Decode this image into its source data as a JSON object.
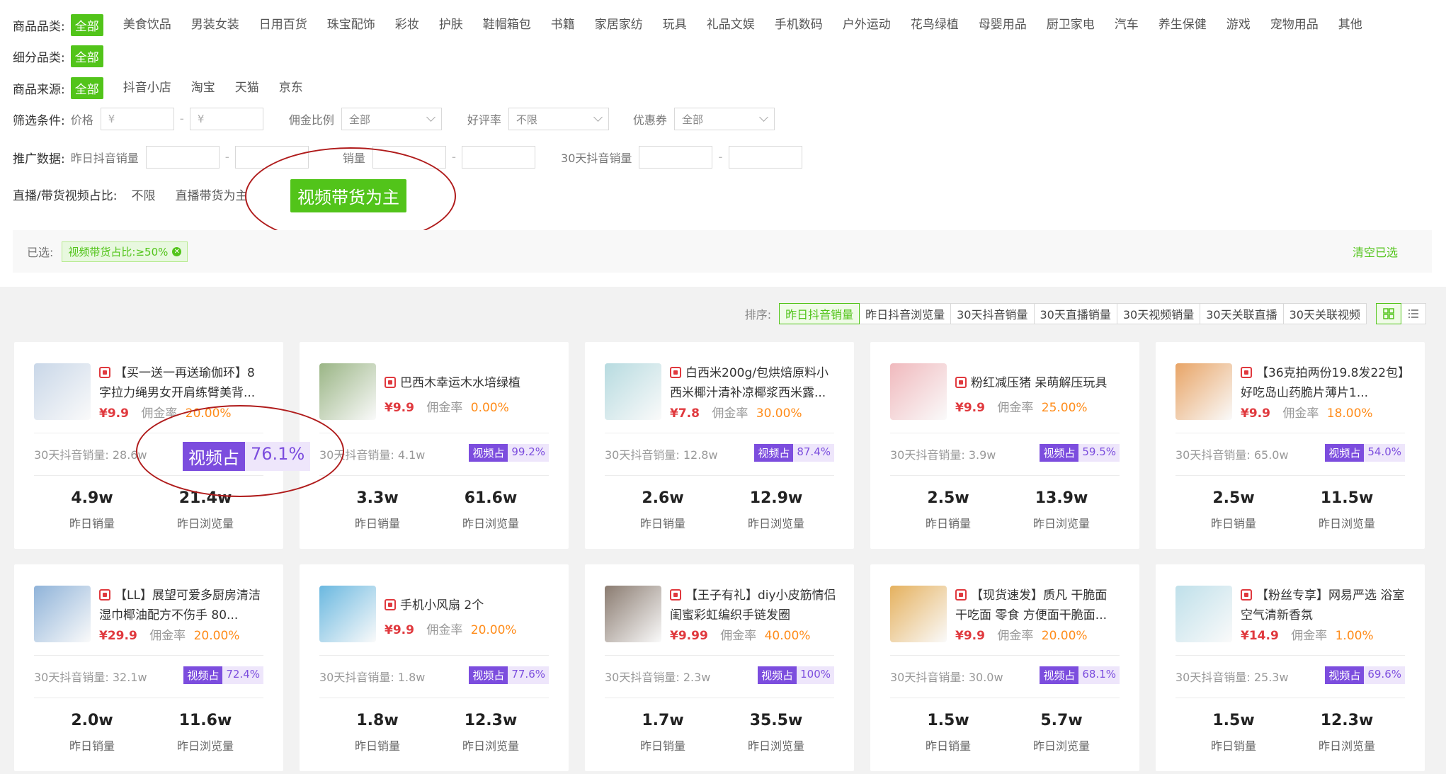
{
  "filters": {
    "category": {
      "label": "商品品类:",
      "options": [
        "全部",
        "美食饮品",
        "男装女装",
        "日用百货",
        "珠宝配饰",
        "彩妆",
        "护肤",
        "鞋帽箱包",
        "书籍",
        "家居家纺",
        "玩具",
        "礼品文娱",
        "手机数码",
        "户外运动",
        "花鸟绿植",
        "母婴用品",
        "厨卫家电",
        "汽车",
        "养生保健",
        "游戏",
        "宠物用品",
        "其他"
      ]
    },
    "subcategory": {
      "label": "细分品类:",
      "options": [
        "全部"
      ]
    },
    "source": {
      "label": "商品来源:",
      "options": [
        "全部",
        "抖音小店",
        "淘宝",
        "天猫",
        "京东"
      ]
    },
    "conditions": {
      "label": "筛选条件:",
      "price_label": "价格",
      "price_min_placeholder": "¥",
      "price_max_placeholder": "¥",
      "commission_label": "佣金比例",
      "commission_value": "全部",
      "rating_label": "好评率",
      "rating_value": "不限",
      "coupon_label": "优惠券",
      "coupon_value": "全部"
    },
    "promo": {
      "label": "推广数据:",
      "yesterday_sales_label": "昨日抖音销量",
      "partial_label": "销量",
      "sales30_label": "30天抖音销量"
    },
    "ratio": {
      "label": "直播/带货视频占比:",
      "options": [
        "不限",
        "直播带货为主"
      ],
      "highlight": "视频带货为主"
    },
    "selected": {
      "label": "已选:",
      "tag": "视频带货占比:≥50%",
      "clear": "清空已选"
    }
  },
  "sort": {
    "label": "排序:",
    "options": [
      "昨日抖音销量",
      "昨日抖音浏览量",
      "30天抖音销量",
      "30天直播销量",
      "30天视频销量",
      "30天关联直播",
      "30天关联视频"
    ]
  },
  "card_labels": {
    "commission": "佣金率",
    "sales30": "30天抖音销量:",
    "video_share": "视频占",
    "yesterday_sales": "昨日销量",
    "yesterday_views": "昨日浏览量"
  },
  "highlight_badge": {
    "key": "视频占",
    "value": "76.1%"
  },
  "products": [
    {
      "title": "【买一送一再送瑜伽环】8字拉力绳男女开肩练臂美背...",
      "price": "¥9.9",
      "commission": "20.00%",
      "sales30": "28.6w",
      "video": "76.1%",
      "ysales": "4.9w",
      "yviews": "21.4w",
      "thumb": "#c9d7e8"
    },
    {
      "title": "巴西木幸运木水培绿植",
      "price": "¥9.9",
      "commission": "0.00%",
      "sales30": "4.1w",
      "video": "99.2%",
      "ysales": "3.3w",
      "yviews": "61.6w",
      "thumb": "#9ab585"
    },
    {
      "title": "白西米200g/包烘焙原料小西米椰汁清补凉椰浆西米露...",
      "price": "¥7.8",
      "commission": "30.00%",
      "sales30": "12.8w",
      "video": "87.4%",
      "ysales": "2.6w",
      "yviews": "12.9w",
      "thumb": "#b7dbe0"
    },
    {
      "title": "粉红减压猪 呆萌解压玩具",
      "price": "¥9.9",
      "commission": "25.00%",
      "sales30": "3.9w",
      "video": "59.5%",
      "ysales": "2.5w",
      "yviews": "13.9w",
      "thumb": "#f0b9bd"
    },
    {
      "title": "【36克拍两份19.8发22包】好吃岛山药脆片薄片1...",
      "price": "¥9.9",
      "commission": "18.00%",
      "sales30": "65.0w",
      "video": "54.0%",
      "ysales": "2.5w",
      "yviews": "11.5w",
      "thumb": "#e8a466"
    },
    {
      "title": "【LL】展望可爱多厨房清洁湿巾椰油配方不伤手 80...",
      "price": "¥29.9",
      "commission": "20.00%",
      "sales30": "32.1w",
      "video": "72.4%",
      "ysales": "2.0w",
      "yviews": "11.6w",
      "thumb": "#8fb3d9"
    },
    {
      "title": "手机小风扇 2个",
      "price": "¥9.9",
      "commission": "20.00%",
      "sales30": "1.8w",
      "video": "77.6%",
      "ysales": "1.8w",
      "yviews": "12.3w",
      "thumb": "#6ab8e0"
    },
    {
      "title": "【王子有礼】diy小皮筋情侣闺蜜彩虹编织手链发圈",
      "price": "¥9.99",
      "commission": "40.00%",
      "sales30": "2.3w",
      "video": "100%",
      "ysales": "1.7w",
      "yviews": "35.5w",
      "thumb": "#8a7b70"
    },
    {
      "title": "【现货速发】质凡 干脆面 干吃面 零食 方便面干脆面...",
      "price": "¥9.9",
      "commission": "20.00%",
      "sales30": "30.0w",
      "video": "68.1%",
      "ysales": "1.5w",
      "yviews": "5.7w",
      "thumb": "#e5b15e"
    },
    {
      "title": "【粉丝专享】网易严选 浴室空气清新香氛",
      "price": "¥14.9",
      "commission": "1.00%",
      "sales30": "25.3w",
      "video": "69.6%",
      "ysales": "1.5w",
      "yviews": "12.3w",
      "thumb": "#bfe0ea"
    }
  ]
}
